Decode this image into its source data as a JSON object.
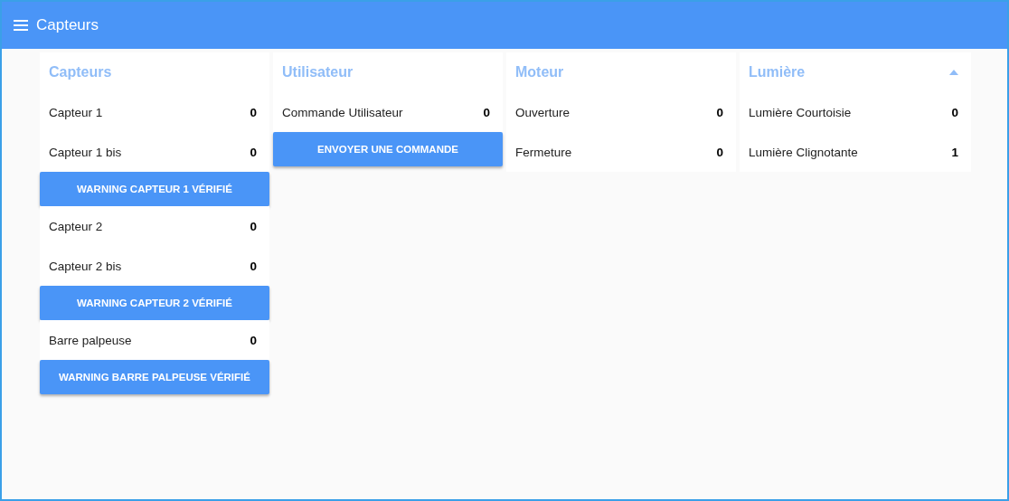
{
  "app_bar": {
    "title": "Capteurs"
  },
  "panels": [
    {
      "title": "Capteurs",
      "items": [
        {
          "kind": "reading",
          "label": "Capteur 1",
          "value": "0"
        },
        {
          "kind": "reading",
          "label": "Capteur 1 bis",
          "value": "0"
        },
        {
          "kind": "button",
          "label": "WARNING CAPTEUR 1 VÉRIFIÉ"
        },
        {
          "kind": "reading",
          "label": "Capteur 2",
          "value": "0"
        },
        {
          "kind": "reading",
          "label": "Capteur 2 bis",
          "value": "0"
        },
        {
          "kind": "button",
          "label": "WARNING CAPTEUR 2 VÉRIFIÉ"
        },
        {
          "kind": "reading",
          "label": "Barre palpeuse",
          "value": "0"
        },
        {
          "kind": "button",
          "label": "WARNING BARRE PALPEUSE VÉRIFIÉ"
        }
      ]
    },
    {
      "title": "Utilisateur",
      "items": [
        {
          "kind": "reading",
          "label": "Commande Utilisateur",
          "value": "0"
        },
        {
          "kind": "button",
          "label": "ENVOYER UNE COMMANDE"
        }
      ]
    },
    {
      "title": "Moteur",
      "items": [
        {
          "kind": "reading",
          "label": "Ouverture",
          "value": "0"
        },
        {
          "kind": "reading",
          "label": "Fermeture",
          "value": "0"
        }
      ]
    },
    {
      "title": "Lumière",
      "expanded": true,
      "items": [
        {
          "kind": "reading",
          "label": "Lumière Courtoisie",
          "value": "0"
        },
        {
          "kind": "reading",
          "label": "Lumière Clignotante",
          "value": "1"
        }
      ]
    }
  ]
}
